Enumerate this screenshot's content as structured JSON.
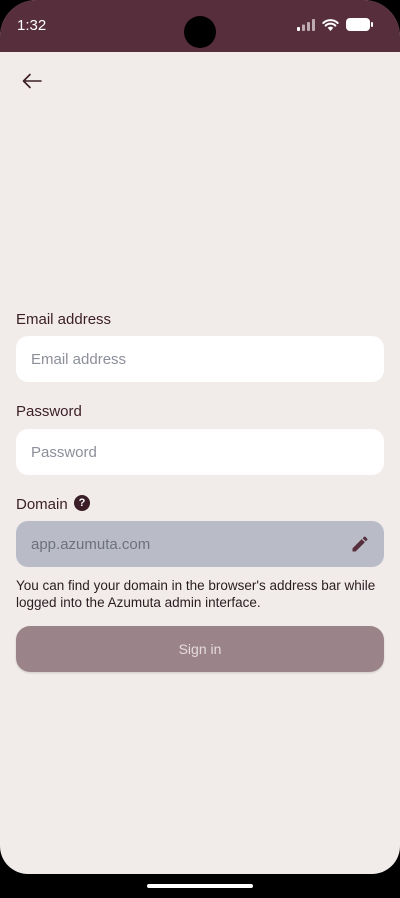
{
  "status_bar": {
    "time": "1:32"
  },
  "form": {
    "email": {
      "label": "Email address",
      "placeholder": "Email address"
    },
    "password": {
      "label": "Password",
      "placeholder": "Password"
    },
    "domain": {
      "label": "Domain",
      "help_glyph": "?",
      "value": "app.azumuta.com",
      "hint": "You can find your domain in the browser's address bar while logged into the Azumuta admin interface."
    },
    "submit_label": "Sign in"
  },
  "colors": {
    "status_bar": "#562e3c",
    "background": "#f1ece9",
    "button_disabled": "#9a848a",
    "domain_field": "#b9bcc6"
  },
  "icons": [
    "back-arrow-icon",
    "camera-icon",
    "signal-icon",
    "wifi-icon",
    "battery-icon",
    "help-icon",
    "pencil-icon"
  ]
}
